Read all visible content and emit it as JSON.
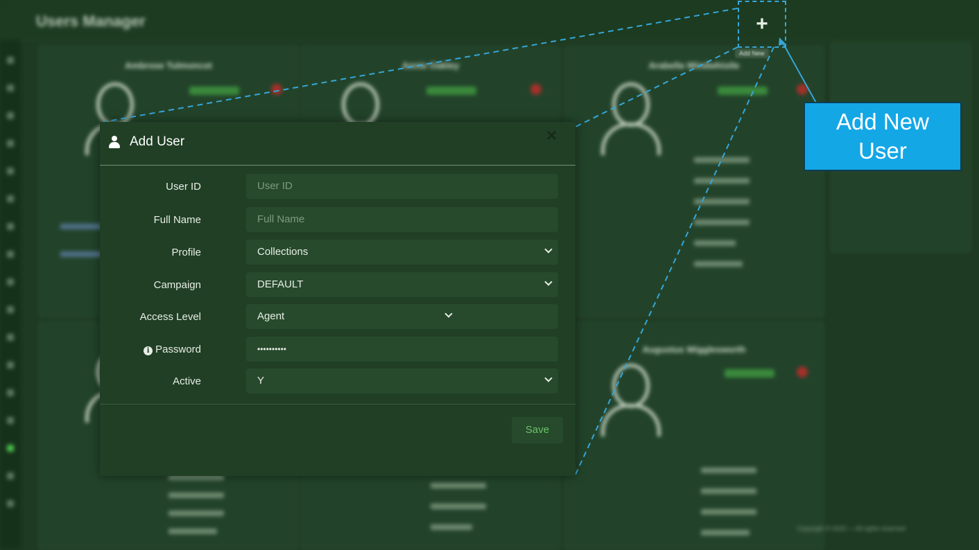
{
  "app": {
    "title": "Users Manager"
  },
  "toolbar": {
    "add_tooltip": "Add New"
  },
  "callout": {
    "text": "Add New\nUser"
  },
  "background": {
    "cards": [
      {
        "name": "Ambrose Tulmoncot"
      },
      {
        "name": "Annie Oakley"
      },
      {
        "name": "Arabella Windwhistle"
      },
      {
        "name": "Augustus Wigglesworth"
      }
    ],
    "footer": "Copyright © 2023 — All rights reserved"
  },
  "modal": {
    "title": "Add User",
    "close_label": "×",
    "fields": {
      "user_id": {
        "label": "User ID",
        "placeholder": "User ID",
        "value": ""
      },
      "full_name": {
        "label": "Full Name",
        "placeholder": "Full Name",
        "value": ""
      },
      "profile": {
        "label": "Profile",
        "value": "Collections"
      },
      "campaign": {
        "label": "Campaign",
        "value": "DEFAULT"
      },
      "access_level": {
        "label": "Access Level",
        "value": "Agent"
      },
      "password": {
        "label": "Password",
        "value": "••••••••••",
        "info_icon": "i"
      },
      "active": {
        "label": "Active",
        "value": "Y"
      }
    },
    "save_label": "Save"
  },
  "colors": {
    "accent": "#14a7e6",
    "save_text": "#69c46a",
    "modal_bg": "#203f25"
  }
}
